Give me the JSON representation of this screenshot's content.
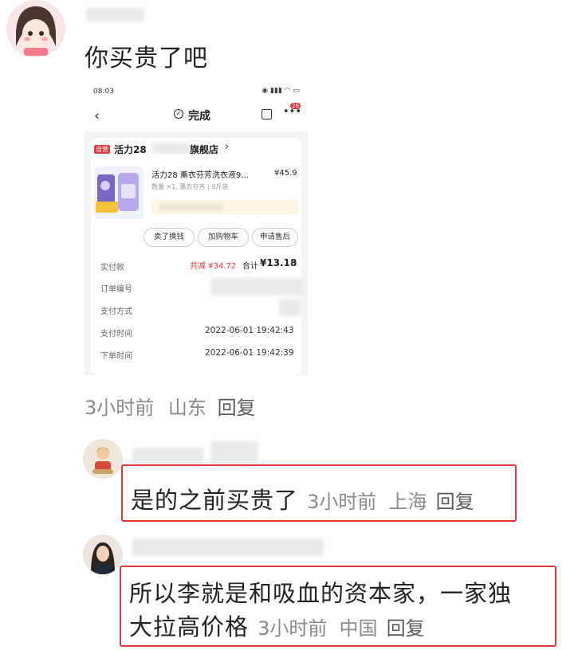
{
  "post": {
    "text": "你买贵了吧",
    "meta_time": "3小时前",
    "meta_location": "山东",
    "meta_reply": "回复"
  },
  "screenshot": {
    "status_time": "08:03",
    "nav_title": "完成",
    "badge": "26",
    "store_tag": "自营",
    "store_prefix": "活力28",
    "store_suffix": "旗舰店",
    "store_chevron": "›",
    "product_name": "活力28 薰衣芬芳洗衣液9…",
    "product_price": "¥45.9",
    "product_spec": "数量 ×1, 薰衣芬芳丨9斤装",
    "buttons": [
      "卖了换钱",
      "加购物车",
      "申请售后"
    ],
    "rows": [
      {
        "label": "实付款",
        "value": ""
      },
      {
        "label": "订单编号",
        "value": ""
      },
      {
        "label": "支付方式",
        "value": ""
      },
      {
        "label": "支付时间",
        "value": "2022-06-01 19:42:43"
      },
      {
        "label": "下单时间",
        "value": "2022-06-01 19:42:39"
      }
    ],
    "discount": "共减 ¥34.72",
    "total_label": "合计",
    "total_value": "¥13.18",
    "total_chevron": "›"
  },
  "replies": [
    {
      "text": "是的之前买贵了",
      "meta_time": "3小时前",
      "meta_location": "上海",
      "meta_reply": "回复"
    },
    {
      "text_line1": "所以李就是和吸血的资本家，一家独",
      "text_line2": "大拉高价格",
      "meta_time": "3小时前",
      "meta_location": "中国",
      "meta_reply": "回复"
    }
  ],
  "colors": {
    "highlight_border": "#e23a3a",
    "price_red": "#e23a3a",
    "meta_gray": "#8a8a8a"
  }
}
